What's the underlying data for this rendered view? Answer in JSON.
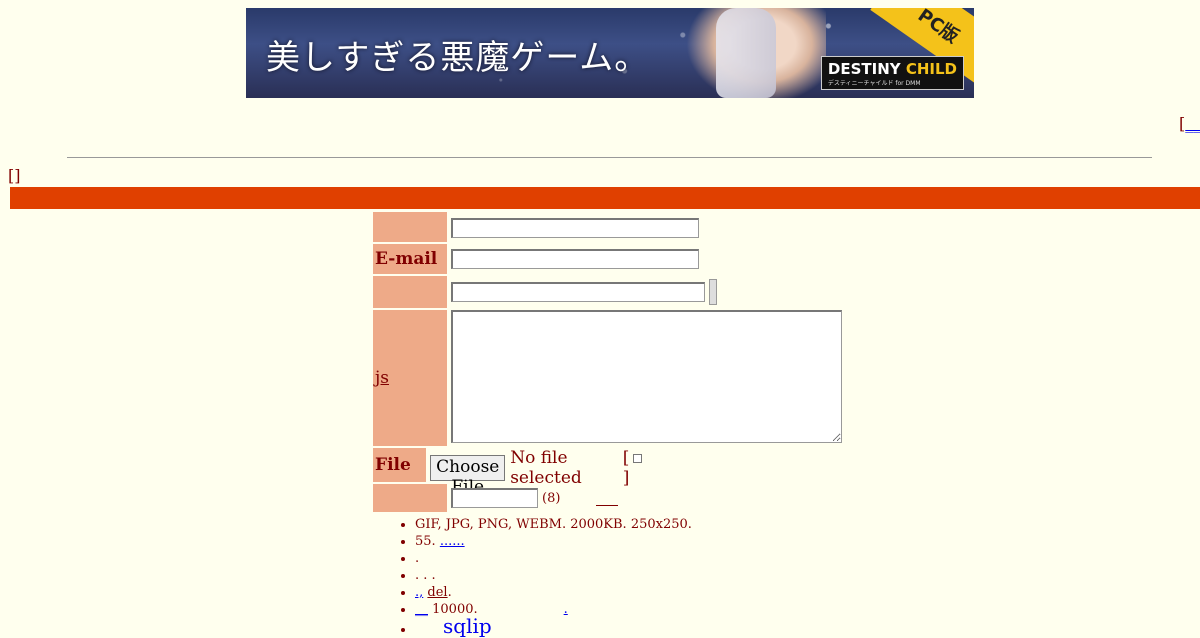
{
  "banner": {
    "tagline": "美しすぎる悪魔ゲーム。",
    "corner_badge": "PC版",
    "logo_main": "DESTINY",
    "logo_accent": "CHILD",
    "logo_sub": "デスティニーチャイルド for DMM"
  },
  "top_link": {
    "bracket": "[",
    "text": "__"
  },
  "bracket_top": "[]",
  "form": {
    "rows": [
      {
        "label": ""
      },
      {
        "label": "E-mail"
      },
      {
        "label": ""
      },
      {
        "label": "js"
      },
      {
        "label": "File"
      },
      {
        "label": ""
      }
    ],
    "file_button": "Choose File",
    "file_status": "No file selected",
    "checkbox_open": "[",
    "checkbox_close": "]",
    "password_hint": "(8)"
  },
  "notes": [
    {
      "text": "GIF, JPG, PNG, WEBM. 2000KB. 250x250."
    },
    {
      "text": "55.",
      "link": "......"
    },
    {
      "text": "."
    },
    {
      "text": ". . ."
    },
    {
      "prefix_link": ".,",
      "link": "del",
      "text": "."
    },
    {
      "prefix_link": "__",
      "text": "10000.",
      "suffix_link": "."
    },
    {
      "link": "sqlip"
    }
  ],
  "colors": {
    "accent_bar": "#e04000",
    "label_bg": "#eeaa88",
    "page_bg": "#ffffee",
    "text": "#800000"
  }
}
